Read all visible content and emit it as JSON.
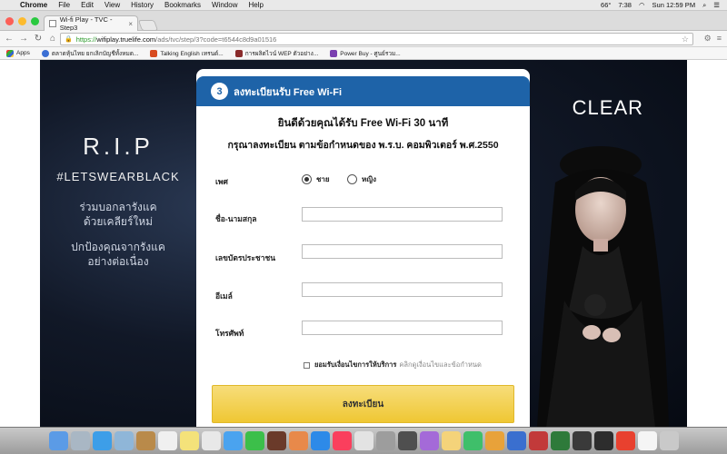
{
  "menubar": {
    "items": [
      "Chrome",
      "File",
      "Edit",
      "View",
      "History",
      "Bookmarks",
      "Window",
      "Help"
    ],
    "battery_temp": "66°",
    "clock_short": "7:38",
    "datetime": "Sun 12:59 PM"
  },
  "browser": {
    "tab_title": "Wi-fi Play - TVC - Step3",
    "url_proto": "https://",
    "url_host": "wifiplay.truelife.com",
    "url_path": "/ads/tvc/step/3?code=t6544c8d9a01516",
    "bookmarks": [
      "Apps",
      "ตลาดหุ้นไทย ยกเลิกบัญชีทั้งหมด...",
      "Talking English เทรนด์...",
      "การผลิตไวน์ WEP ตัวอย่าง...",
      "Power Buy - ศูนย์รวม..."
    ],
    "colors": {
      "tab_bg": "#f6f6f6",
      "lock": "#2a9a2a"
    }
  },
  "banner": {
    "rip": "R.I.P",
    "hashtag": "#LETSWEARBLACK",
    "line1a": "ร่วมบอกลารังแค",
    "line1b": "ด้วยเคลียร์ใหม่",
    "line2a": "ปกป้องคุณจากรังแค",
    "line2b": "อย่างต่อเนื่อง",
    "brand": "CLEAR"
  },
  "form": {
    "step_number": "3",
    "step_title": "ลงทะเบียนรับ Free Wi-Fi",
    "headline1": "ยินดีด้วยคุณได้รับ Free Wi-Fi 30 นาที",
    "headline2": "กรุณาลงทะเบียน ตามข้อกำหนดของ พ.ร.บ. คอมพิวเตอร์ พ.ศ.2550",
    "gender_label": "เพศ",
    "gender_male": "ชาย",
    "gender_female": "หญิง",
    "name_label": "ชื่อ-นามสกุล",
    "id_label": "เลขบัตรประชาชน",
    "email_label": "อีเมล์",
    "phone_label": "โทรศัพท์",
    "consent_bold": "ยอมรับเงื่อนไขการให้บริการ",
    "consent_link": "คลิกดูเงื่อนไขและข้อกำหนด",
    "submit": "ลงทะเบียน",
    "colors": {
      "stepbar": "#1e63a8",
      "submit": "#efc733"
    }
  }
}
